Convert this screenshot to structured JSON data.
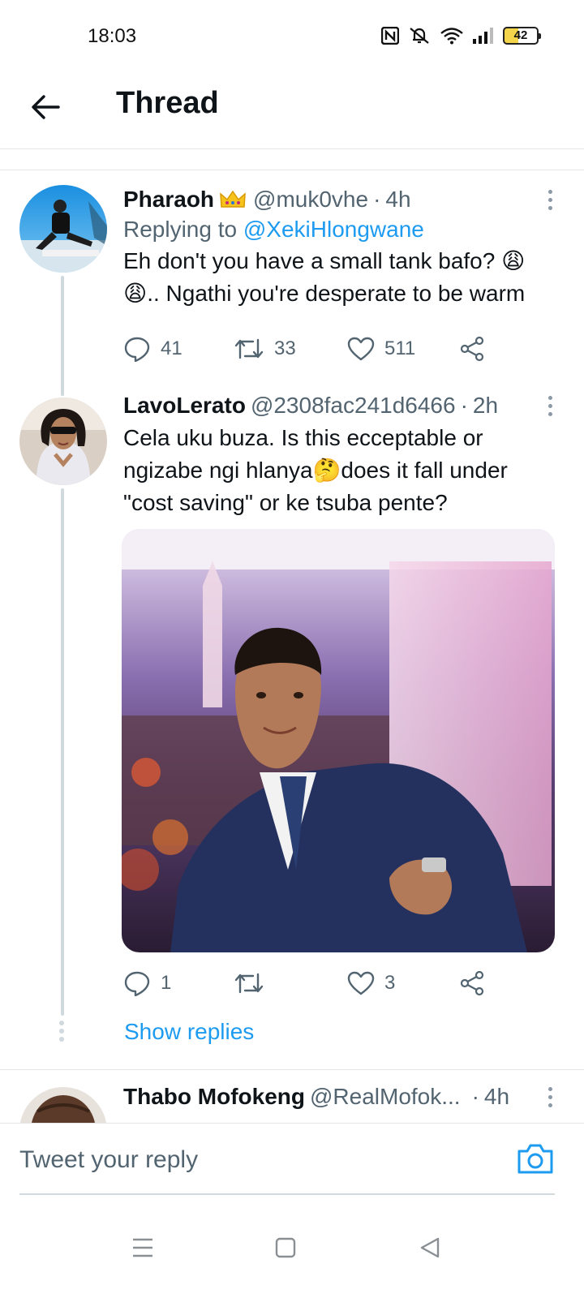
{
  "status_bar": {
    "time": "18:03",
    "battery": "42",
    "nfc_icon": "nfc-icon",
    "mute_icon": "mute-icon",
    "wifi_icon": "wifi-icon",
    "signal_icon": "signal-icon"
  },
  "header": {
    "title": "Thread",
    "back_icon": "arrow-left-icon"
  },
  "tweets": [
    {
      "name": "Pharaoh",
      "badge_icon": "crown-icon",
      "handle": "@muk0vhe",
      "separator": "·",
      "time": "4h",
      "replying_prefix": "Replying to ",
      "replying_handle": "@XekiHlongwane",
      "text_line1": "Eh don't you have a small tank bafo? 😩",
      "text_line2": "😩.. Ngathi you're desperate to be warm",
      "replies": "41",
      "retweets": "33",
      "likes": "511"
    },
    {
      "name": "LavoLerato",
      "handle": "@2308fac241d6466",
      "separator": "·",
      "time": "2h",
      "text_line1": "Cela uku buza. Is this ecceptable or",
      "text_line2": "ngizabe ngi hlanya🤔does it fall under",
      "text_line3": "\"cost saving\" or ke tsuba pente?",
      "media_icon": "photo-man-in-suit",
      "replies": "1",
      "retweets": "",
      "likes": "3"
    },
    {
      "name": "Thabo Mofokeng",
      "handle": "@RealMofok...",
      "separator": "·",
      "time": "4h"
    }
  ],
  "show_replies": "Show replies",
  "reply_bar": {
    "placeholder": "Tweet your reply",
    "camera_icon": "camera-icon"
  },
  "nav_bar": {
    "menu_icon": "menu-icon",
    "home_icon": "square-home-icon",
    "back_icon": "triangle-back-icon"
  },
  "colors": {
    "accent": "#1d9bf0",
    "text": "#0f1419",
    "muted": "#536471",
    "divider": "#e4e6e8",
    "thread_line": "#cfd9de"
  }
}
